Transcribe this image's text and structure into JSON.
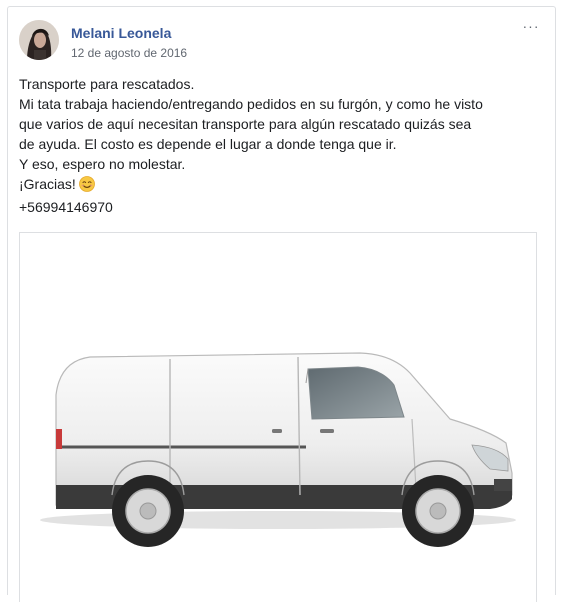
{
  "post": {
    "author": "Melani Leonela",
    "date": "12 de agosto de 2016",
    "more_label": "···",
    "lines": [
      "Transporte para rescatados.",
      "Mi tata trabaja haciendo/entregando pedidos en su furgón, y como he visto",
      "que varios de aquí necesitan transporte para algún rescatado quizás sea",
      "de ayuda. El costo es depende el lugar a donde tenga que ir.",
      "Y eso, espero no molestar.",
      "¡Gracias!",
      "+56994146970"
    ],
    "emoji": "smiling-face-icon"
  },
  "colors": {
    "author": "#385898",
    "meta": "#616770",
    "text": "#1c1e21",
    "border": "#dddfe2"
  }
}
